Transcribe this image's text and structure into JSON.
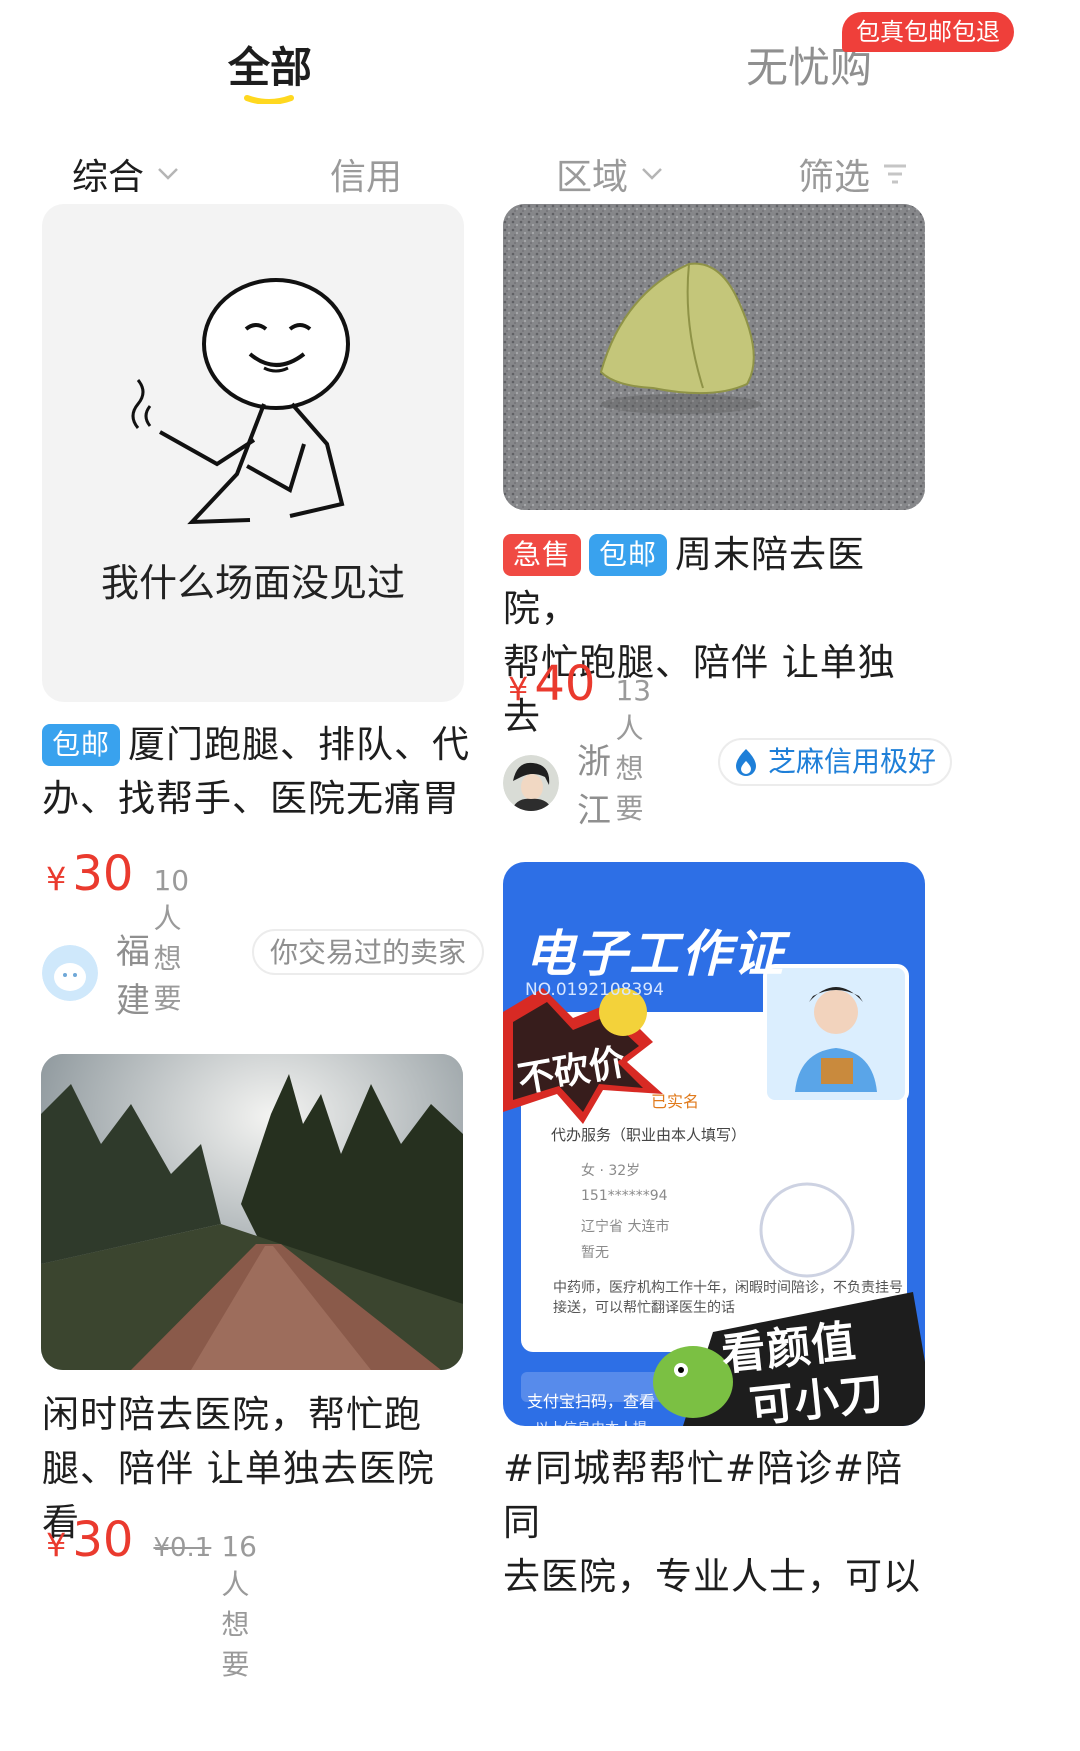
{
  "top_tabs": {
    "all": "全部",
    "worry_free": "无忧购",
    "promo_badge": "包真包邮包退"
  },
  "filters": {
    "comprehensive": "综合",
    "credit": "信用",
    "region": "区域",
    "screen": "筛选"
  },
  "cards": [
    {
      "image_caption": "我什么场面没见过",
      "tags": [
        "包邮"
      ],
      "title_line1": "厦门跑腿、排队、代",
      "title_line2": "办、找帮手、医院无痛胃",
      "price_symbol": "¥",
      "price": "30",
      "want": "10人想要",
      "region": "福建",
      "badge": "你交易过的卖家"
    },
    {
      "tags": [
        "急售",
        "包邮"
      ],
      "title_line1": "周末陪去医院，",
      "title_line2": "帮忙跑腿、陪伴 让单独去",
      "price_symbol": "¥",
      "price": "40",
      "want": "13人想要",
      "region": "浙江",
      "badge": "芝麻信用极好"
    },
    {
      "title_line1": "闲时陪去医院，帮忙跑",
      "title_line2": "腿、陪伴 让单独去医院看",
      "price_symbol": "¥",
      "price": "30",
      "original_price": "¥0.1",
      "want": "16人想要"
    },
    {
      "work_badge": {
        "title": "电子工作证",
        "number": "NO.0192108394",
        "verified": "已实名",
        "service": "代办服务（职业由本人填写）",
        "gender_age": "女 · 32岁",
        "phone": "151******94",
        "location": "辽宁省 大连市",
        "other": "暂无",
        "description": "中药师，医疗机构工作十年，闲暇时间陪诊，不负责挂号接送，可以帮忙翻译医生的话",
        "scan": "支付宝扫码，查看",
        "footer": "以上信息由本人提",
        "sticker_no_bargain": "不砍价",
        "sticker_looks_1": "看颜值",
        "sticker_looks_2": "可小刀"
      },
      "title_line1": "#同城帮帮忙#陪诊#陪同",
      "title_line2": "去医院，专业人士，可以"
    }
  ],
  "colors": {
    "accent_yellow": "#ffd81f",
    "price_red": "#ea3a2e",
    "tag_red": "#f04a43",
    "tag_blue": "#39a2ee",
    "credit_blue": "#1e7fd8",
    "work_badge_blue": "#2d6fe6"
  },
  "icons": [
    "chevron-down-icon",
    "filter-icon",
    "flame-icon",
    "avatar-icon"
  ]
}
